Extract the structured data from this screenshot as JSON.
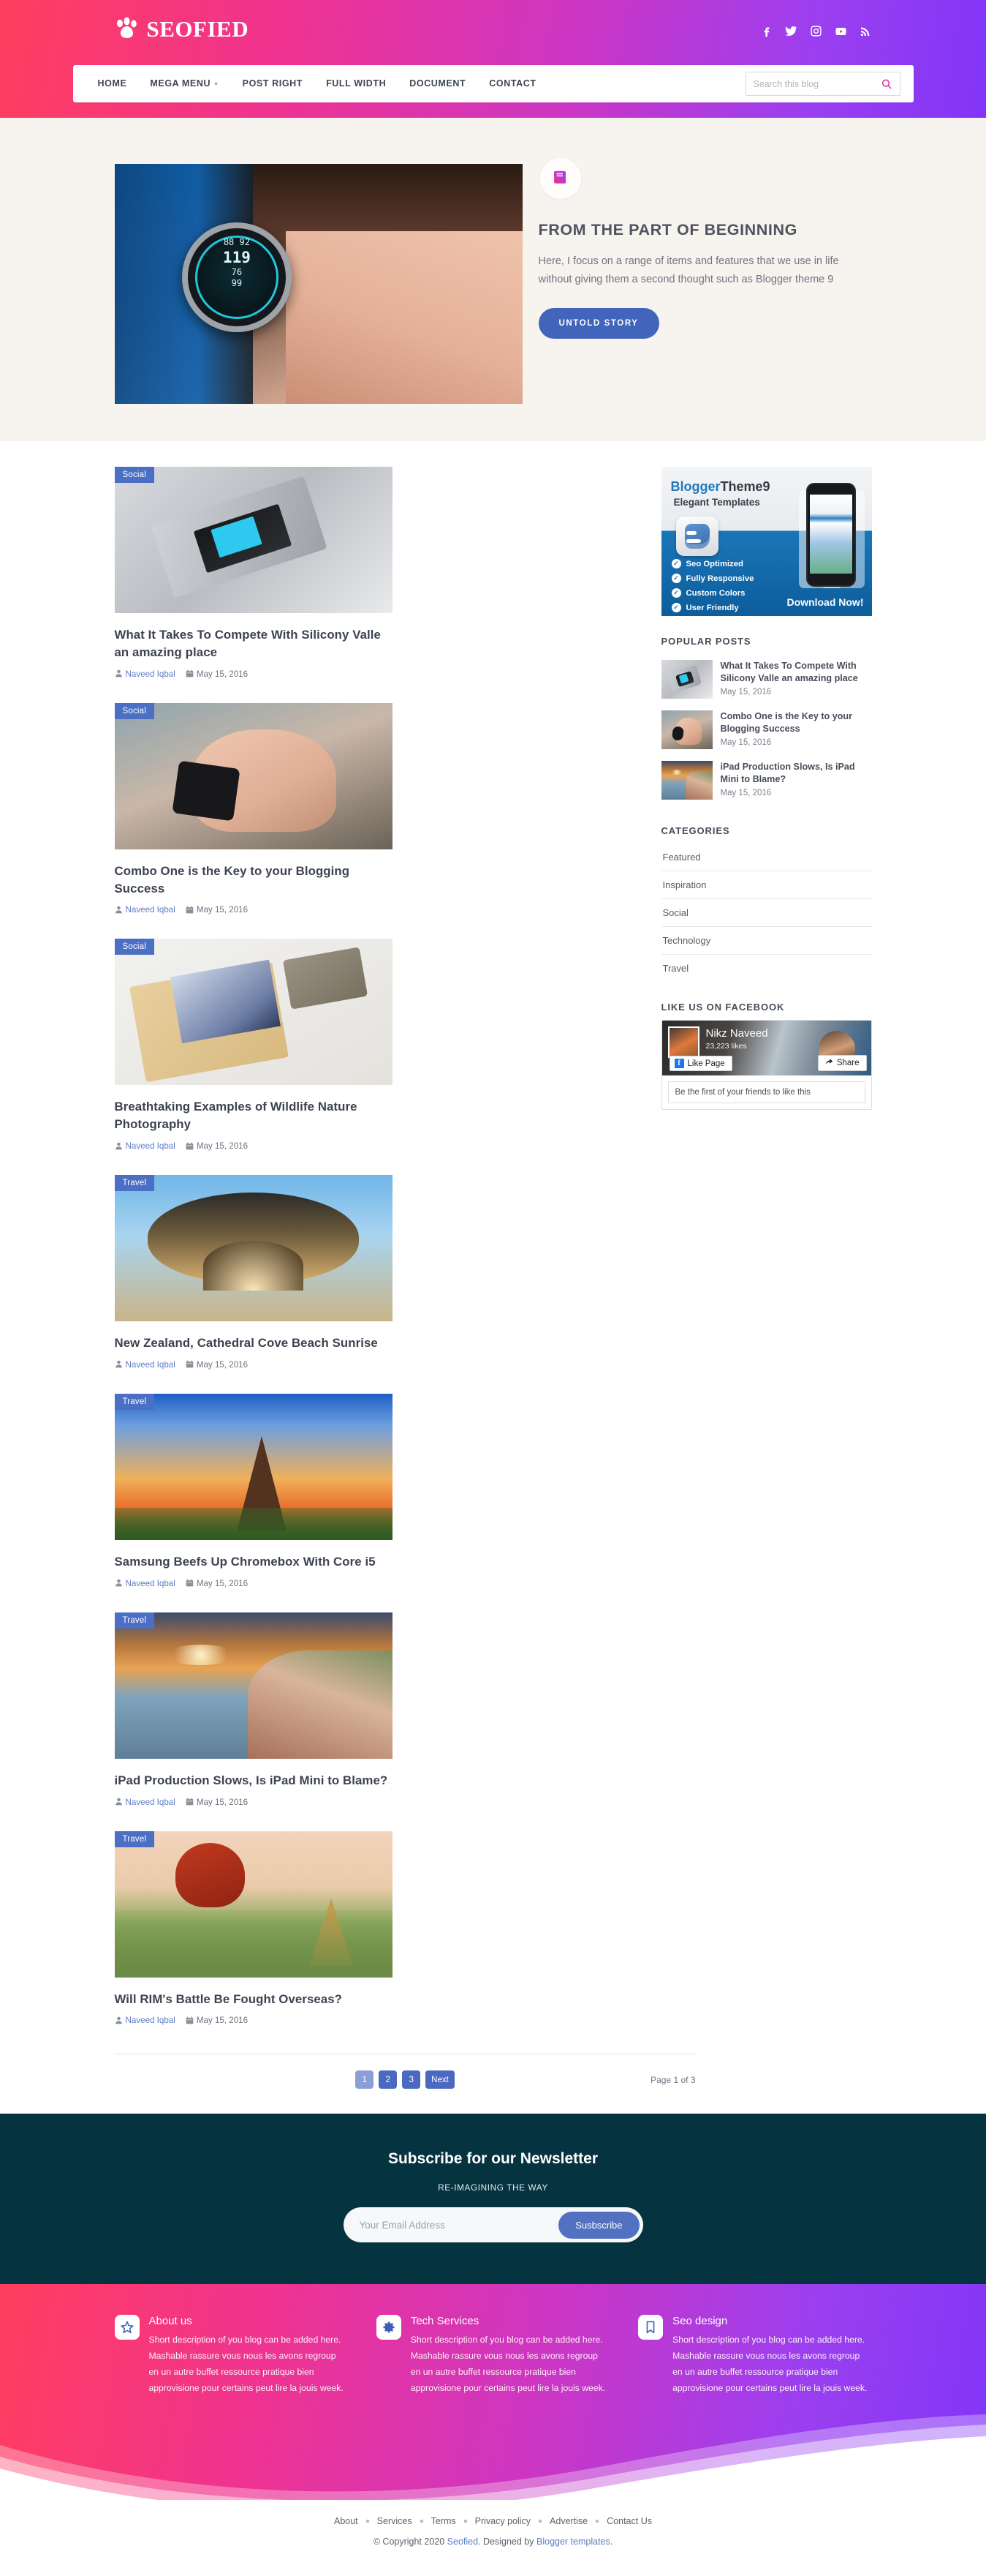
{
  "header": {
    "brand": "SEOFIED",
    "brand_icon": "paw-icon",
    "social": [
      {
        "name": "facebook-icon",
        "label": "Facebook"
      },
      {
        "name": "twitter-icon",
        "label": "Twitter"
      },
      {
        "name": "instagram-icon",
        "label": "Instagram"
      },
      {
        "name": "youtube-icon",
        "label": "YouTube"
      },
      {
        "name": "rss-icon",
        "label": "RSS"
      }
    ],
    "nav": [
      {
        "label": "HOME",
        "dropdown": false
      },
      {
        "label": "MEGA MENU",
        "dropdown": true
      },
      {
        "label": "POST RIGHT",
        "dropdown": false
      },
      {
        "label": "FULL WIDTH",
        "dropdown": false
      },
      {
        "label": "DOCUMENT",
        "dropdown": false
      },
      {
        "label": "CONTACT",
        "dropdown": false
      }
    ],
    "search": {
      "placeholder": "Search this blog",
      "value": ""
    },
    "colors": {
      "gradient_start": "#ff3e5e",
      "gradient_end": "#8235f7",
      "accent": "#e0319a"
    }
  },
  "hero": {
    "badge_icon": "book-icon",
    "title": "FROM THE PART OF BEGINNING",
    "description": "Here, I focus on a range of items and features that we use in life without giving them a second thought such as Blogger theme 9",
    "button": "UNTOLD STORY",
    "button_color": "#4065bb",
    "watch_values": {
      "bpm_top": "88  92",
      "big": "119",
      "mid": "76",
      "small": "99"
    }
  },
  "posts": [
    {
      "category": "Social",
      "title": "What It Takes To Compete With Silicony Valle an amazing place",
      "author": "Naveed Iqbal",
      "date": "May 15, 2016",
      "thumb_class": "t1"
    },
    {
      "category": "Social",
      "title": "Combo One is the Key to your Blogging Success",
      "author": "Naveed Iqbal",
      "date": "May 15, 2016",
      "thumb_class": "t2"
    },
    {
      "category": "Social",
      "title": "Breathtaking Examples of Wildlife Nature Photography",
      "author": "Naveed Iqbal",
      "date": "May 15, 2016",
      "thumb_class": "t3"
    },
    {
      "category": "Travel",
      "title": "New Zealand, Cathedral Cove Beach Sunrise",
      "author": "Naveed Iqbal",
      "date": "May 15, 2016",
      "thumb_class": "t4"
    },
    {
      "category": "Travel",
      "title": "Samsung Beefs Up Chromebox With Core i5",
      "author": "Naveed Iqbal",
      "date": "May 15, 2016",
      "thumb_class": "t5"
    },
    {
      "category": "Travel",
      "title": "iPad Production Slows, Is iPad Mini to Blame?",
      "author": "Naveed Iqbal",
      "date": "May 15, 2016",
      "thumb_class": "t6"
    },
    {
      "category": "Travel",
      "title": "Will RIM's Battle Be Fought Overseas?",
      "author": "Naveed Iqbal",
      "date": "May 15, 2016",
      "thumb_class": "t7"
    }
  ],
  "sidebar": {
    "ad": {
      "title_a": "Blogger",
      "title_b": "Theme9",
      "subtitle": "Elegant Templates",
      "features": [
        "Seo Optimized",
        "Fully Responsive",
        "Custom Colors",
        "User Friendly"
      ],
      "cta": "Download Now!"
    },
    "popular_heading": "POPULAR POSTS",
    "popular": [
      {
        "title": "What It Takes To Compete With Silicony Valle an amazing place",
        "date": "May 15, 2016",
        "thumb_class": "t1"
      },
      {
        "title": "Combo One is the Key to your Blogging Success",
        "date": "May 15, 2016",
        "thumb_class": "t2"
      },
      {
        "title": "iPad Production Slows, Is iPad Mini to Blame?",
        "date": "May 15, 2016",
        "thumb_class": "t6"
      }
    ],
    "categories_heading": "CATEGORIES",
    "categories": [
      "Featured",
      "Inspiration",
      "Social",
      "Technology",
      "Travel"
    ],
    "facebook_heading": "LIKE US ON FACEBOOK",
    "facebook": {
      "page_name": "Nikz Naveed",
      "likes": "23,223 likes",
      "like_button": "Like Page",
      "share_button": "Share",
      "footer_text": "Be the first of your friends to like this",
      "face_caption": "Nikz Naveed"
    }
  },
  "pagination": {
    "pages": [
      "1",
      "2",
      "3"
    ],
    "next": "Next",
    "active_index": 0,
    "info": "Page 1 of 3"
  },
  "newsletter": {
    "title": "Subscribe for our Newsletter",
    "subtitle": "RE-IMAGINING THE WAY",
    "placeholder": "Your Email Address",
    "value": "",
    "button": "Susbscribe"
  },
  "footer_widgets": [
    {
      "icon": "star-icon",
      "title": "About us",
      "text": "Short description of you blog can be added here. Mashable rassure vous nous les avons regroup en un autre buffet ressource pratique bien approvisione pour certains peut lire la jouis week."
    },
    {
      "icon": "gear-icon",
      "title": "Tech Services",
      "text": "Short description of you blog can be added here. Mashable rassure vous nous les avons regroup en un autre buffet ressource pratique bien approvisione pour certains peut lire la jouis week."
    },
    {
      "icon": "bookmark-icon",
      "title": "Seo design",
      "text": "Short description of you blog can be added here. Mashable rassure vous nous les avons regroup en un autre buffet ressource pratique bien approvisione pour certains peut lire la jouis week."
    }
  ],
  "footer": {
    "links": [
      "About",
      "Services",
      "Terms",
      "Privacy policy",
      "Advertise",
      "Contact Us"
    ],
    "copyright_prefix": "© Copyright 2020 ",
    "copyright_brand": "Seofied",
    "copyright_mid": ". Designed by ",
    "copyright_link": "Blogger templates",
    "copyright_suffix": "."
  }
}
